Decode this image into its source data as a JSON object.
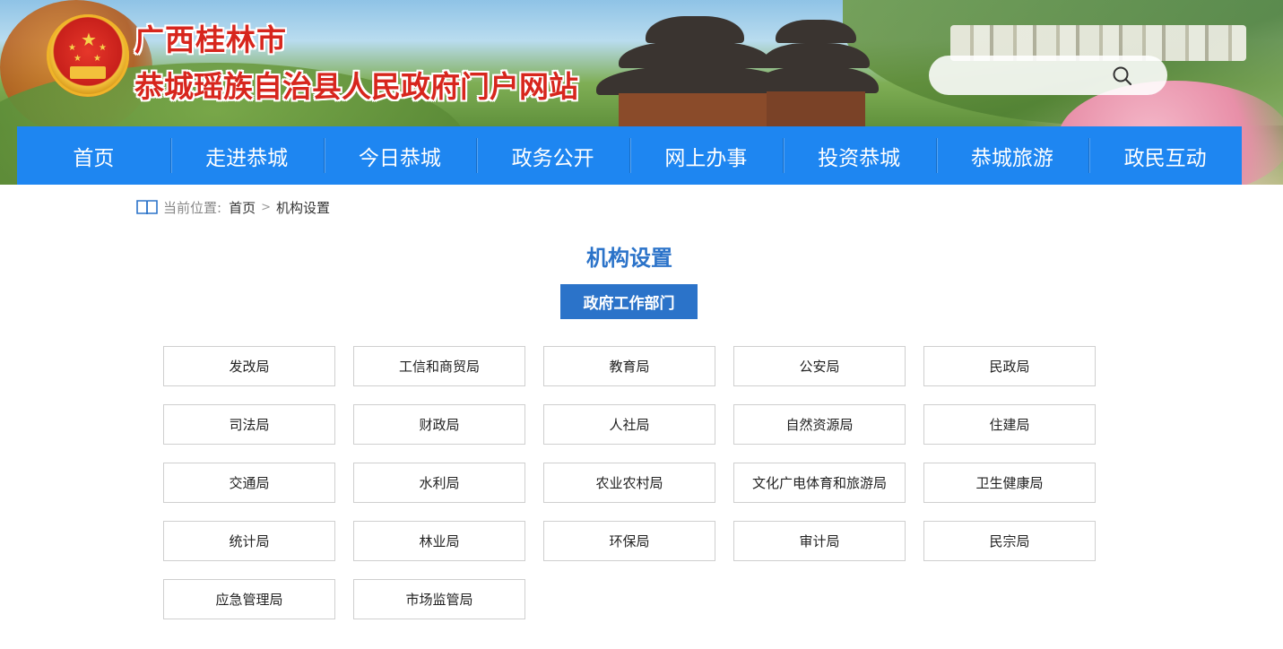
{
  "header": {
    "title_line1": "广西桂林市",
    "title_line2": "恭城瑶族自治县人民政府门户网站",
    "search": {
      "placeholder": "",
      "icon": "search-icon"
    }
  },
  "nav": {
    "items": [
      "首页",
      "走进恭城",
      "今日恭城",
      "政务公开",
      "网上办事",
      "投资恭城",
      "恭城旅游",
      "政民互动"
    ]
  },
  "breadcrumb": {
    "label": "当前位置:",
    "home": "首页",
    "separator": ">",
    "current": "机构设置",
    "icon": "book-icon"
  },
  "page": {
    "title": "机构设置",
    "section_tab": "政府工作部门"
  },
  "departments": [
    "发改局",
    "工信和商贸局",
    "教育局",
    "公安局",
    "民政局",
    "司法局",
    "财政局",
    "人社局",
    "自然资源局",
    "住建局",
    "交通局",
    "水利局",
    "农业农村局",
    "文化广电体育和旅游局",
    "卫生健康局",
    "统计局",
    "林业局",
    "环保局",
    "审计局",
    "民宗局",
    "应急管理局",
    "市场监管局"
  ],
  "colors": {
    "nav_bg": "#1e86f1",
    "accent": "#2b73c9",
    "title_red": "#d7261d"
  }
}
